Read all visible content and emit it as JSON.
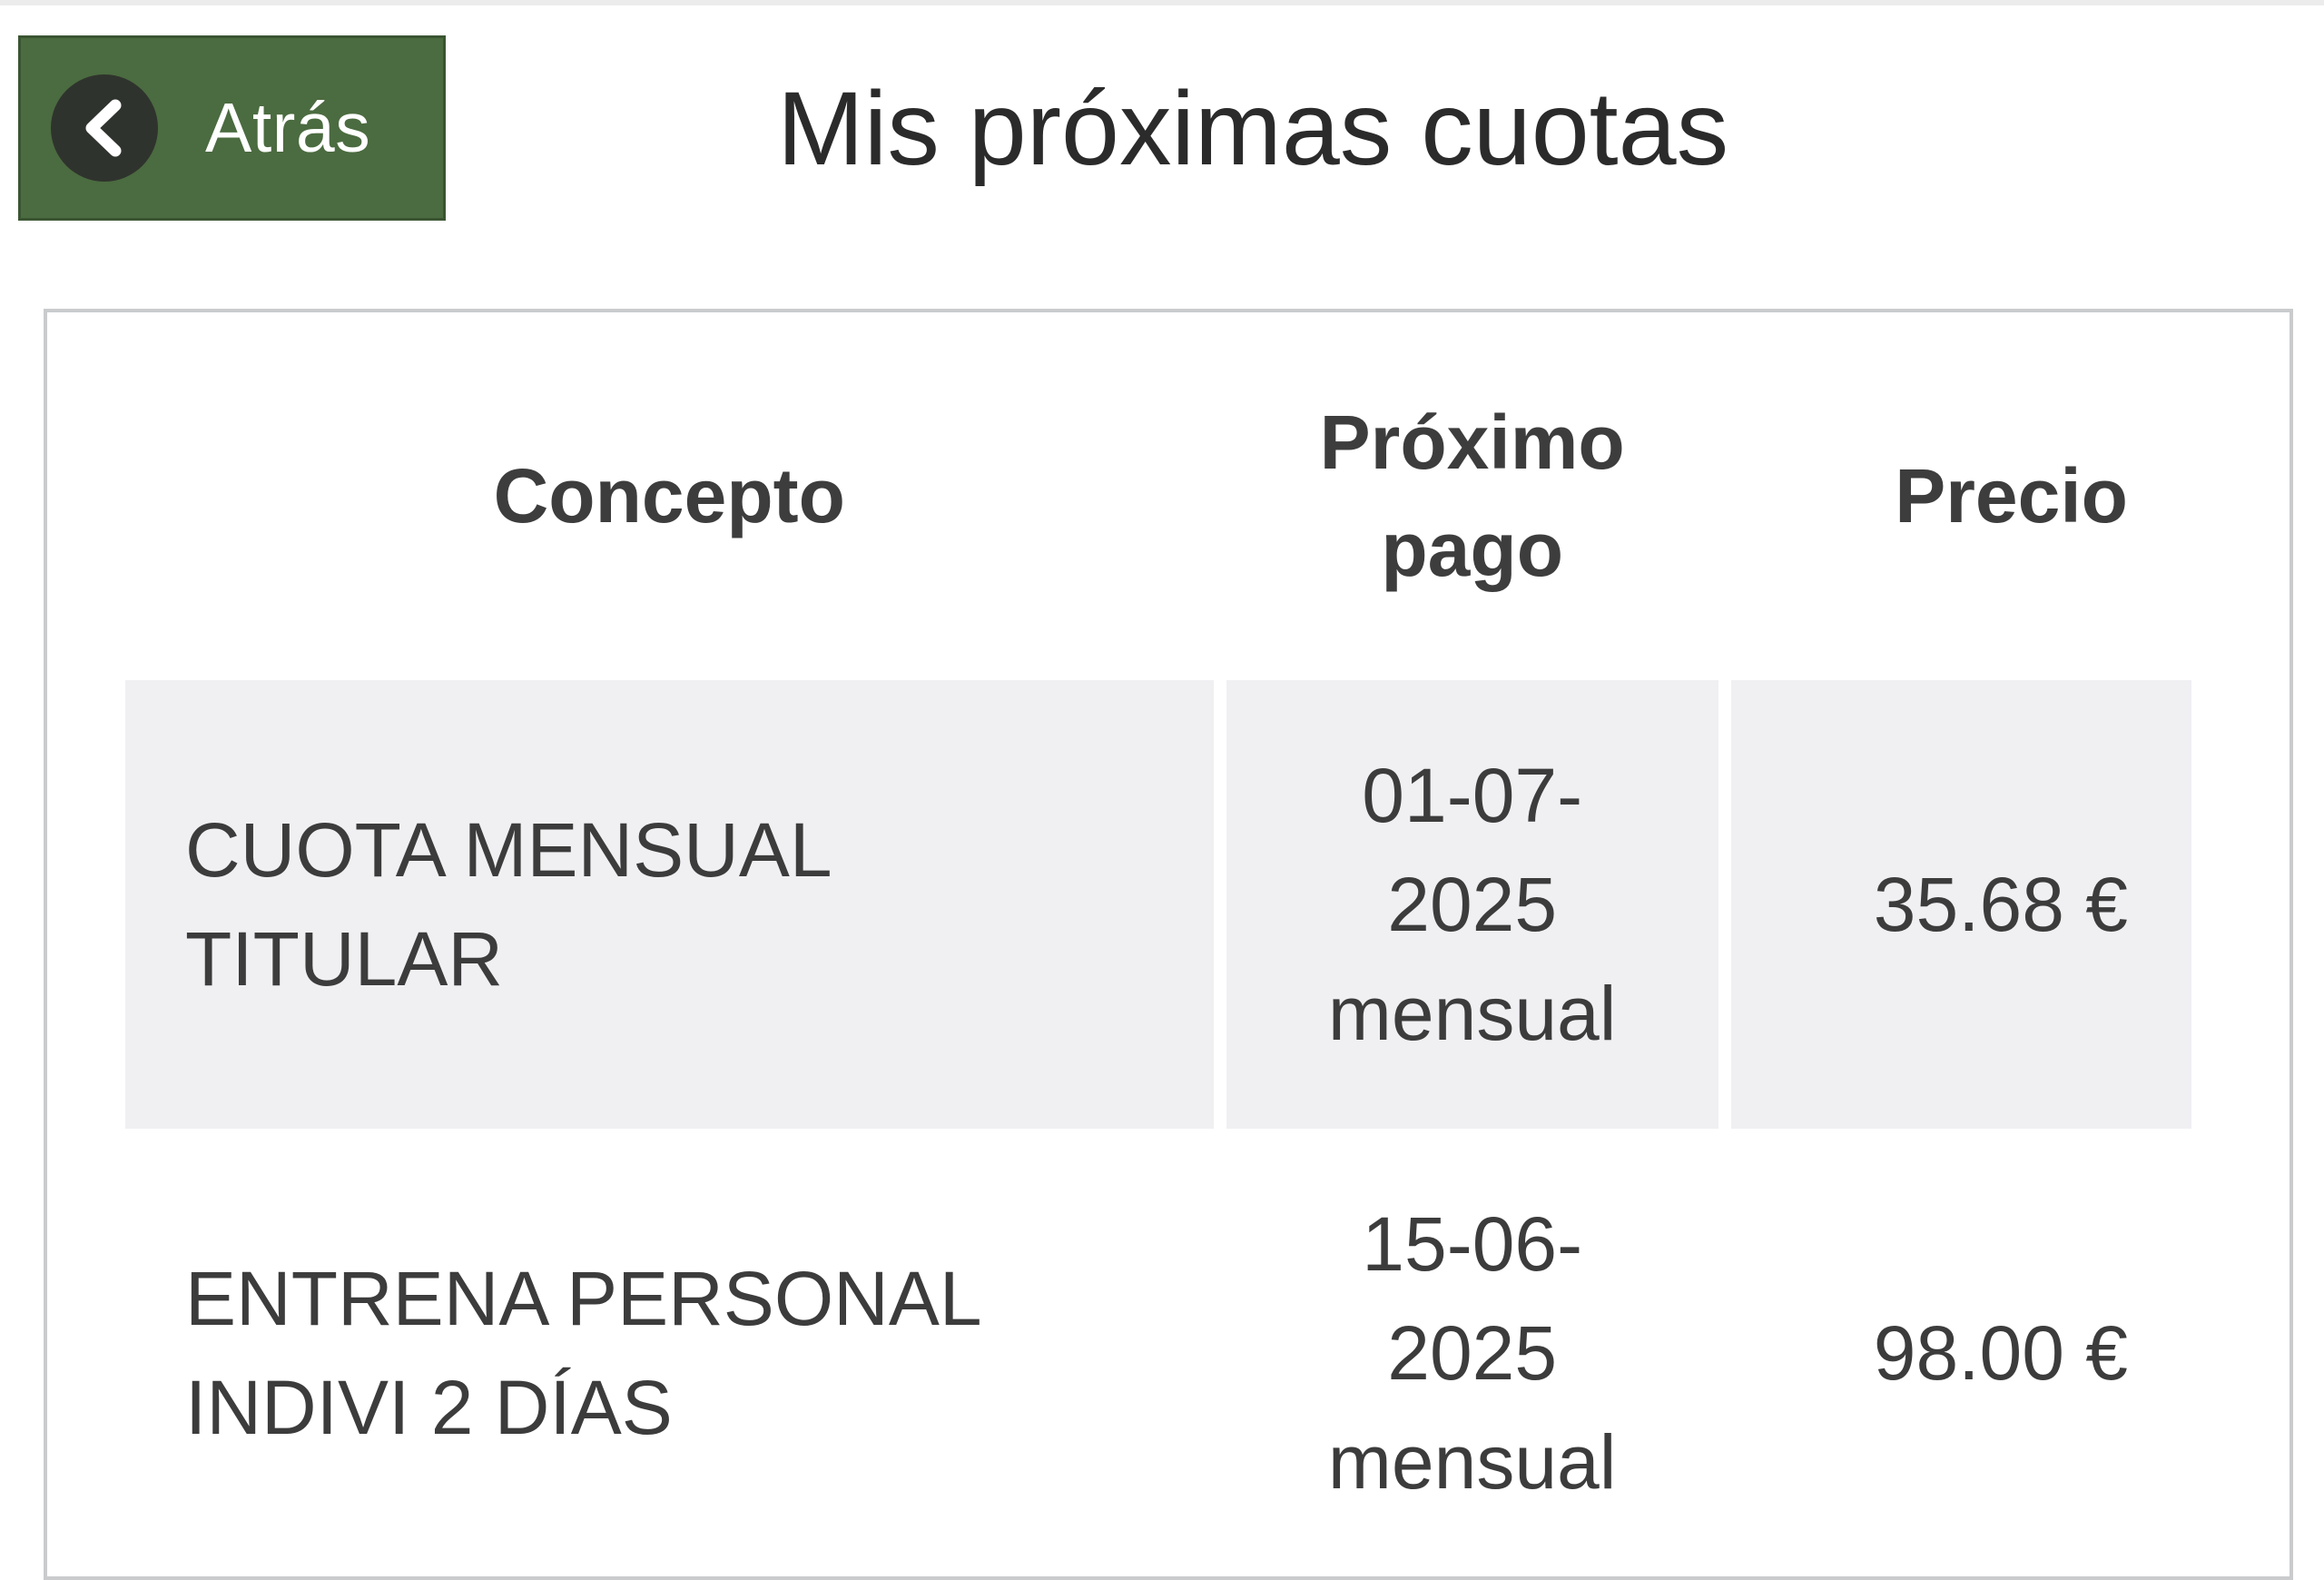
{
  "header": {
    "back_label": "Atrás",
    "back_icon": "chevron-left-icon",
    "title": "Mis próximas cuotas"
  },
  "table": {
    "columns": {
      "concepto": "Concepto",
      "pago_line1": "Próximo",
      "pago_line2": "pago",
      "precio": "Precio"
    },
    "rows": [
      {
        "concepto_line1": "CUOTA MENSUAL",
        "concepto_line2": "TITULAR",
        "fecha_line1": "01-07-",
        "fecha_line2": "2025",
        "periodicidad": "mensual",
        "precio": "35.68 €"
      },
      {
        "concepto_line1": "ENTRENA PERSONAL",
        "concepto_line2": "INDIVI 2 DÍAS",
        "fecha_line1": "15-06-",
        "fecha_line2": "2025",
        "periodicidad": "mensual",
        "precio": "98.00 €"
      }
    ]
  },
  "colors": {
    "back_button": "#4b6b40",
    "back_icon_circle": "#2f332d",
    "row_shade": "#f0eff2",
    "card_border": "#c9cbcd"
  }
}
